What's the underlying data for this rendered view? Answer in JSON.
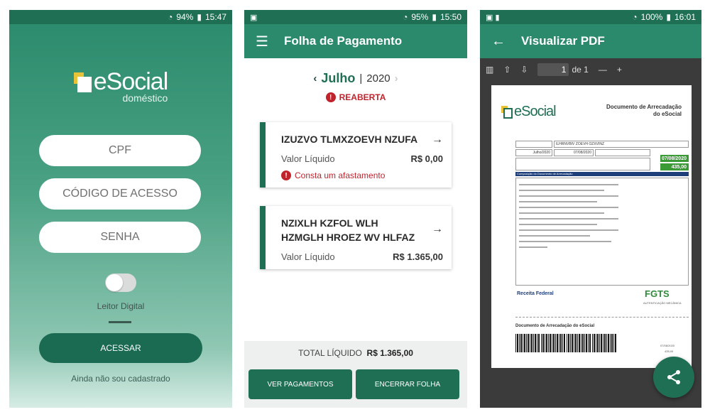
{
  "screen1": {
    "status": {
      "signal": "94%",
      "time": "15:47"
    },
    "logo": {
      "brand": "eSocial",
      "sub": "doméstico"
    },
    "inputs": {
      "cpf": "CPF",
      "codigo": "CÓDIGO DE ACESSO",
      "senha": "SENHA"
    },
    "toggle_label": "Leitor Digital",
    "button": "ACESSAR",
    "link": "Ainda não sou cadastrado"
  },
  "screen2": {
    "status": {
      "signal": "95%",
      "time": "15:50"
    },
    "title": "Folha de Pagamento",
    "month": "Julho",
    "year": "2020",
    "status_text": "REABERTA",
    "cards": [
      {
        "name": "IZUZVO TLMXZOEVH NZUFA",
        "label": "Valor Líquido",
        "value": "R$ 0,00",
        "warning": "Consta um afastamento"
      },
      {
        "name": "NZIXLH KZFOL WLH HZMGLH HROEZ WV HLFAZ",
        "label": "Valor Líquido",
        "value": "R$ 1.365,00"
      }
    ],
    "total_label": "TOTAL LÍQUIDO",
    "total_value": "R$ 1.365,00",
    "btn_pagamentos": "VER PAGAMENTOS",
    "btn_encerrar": "ENCERRAR FOLHA"
  },
  "screen3": {
    "status": {
      "signal": "100%",
      "time": "16:01"
    },
    "title": "Visualizar PDF",
    "page_current": "1",
    "page_total": "de 1",
    "pdf": {
      "brand": "eSocial",
      "doc_title_1": "Documento de Arrecadação",
      "doc_title_2": "do eSocial",
      "name_field": "ILHRNVBIV ZOEVH OZXVINZ",
      "comp": "Julho/2020",
      "date1": "07/08/2020",
      "due": "07/08/2020",
      "amount": "435,00",
      "table_header": "Composição do Documento de Arrecadação",
      "receita": "Receita Federal",
      "fgts": "FGTS",
      "autenticacao": "AUTENTICAÇÃO MECÂNICA",
      "section2": "Documento de Arrecadação do eSocial",
      "due2": "07/08/2020",
      "amount2": "435,00"
    }
  }
}
